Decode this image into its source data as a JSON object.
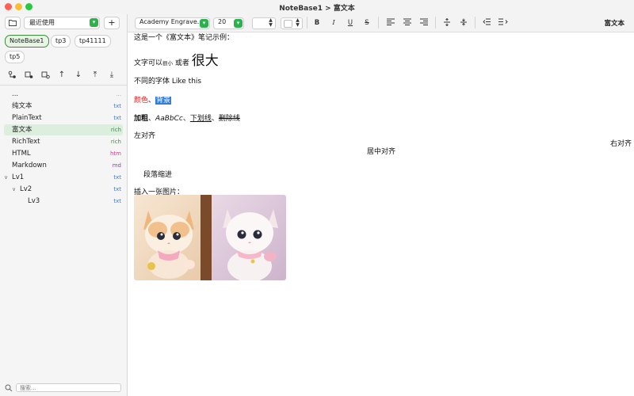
{
  "window": {
    "title": "NoteBase1 > 富文本"
  },
  "sidebar": {
    "recent_select": "最近使用",
    "add_label": "+",
    "bases": [
      "NoteBase1",
      "tp3",
      "tp41111",
      "tp5"
    ],
    "actions": [
      "add-child-icon",
      "add-sibling-icon",
      "settings-node-icon",
      "move-up-icon",
      "move-down-icon",
      "move-top-icon",
      "move-bottom-icon"
    ],
    "items": [
      {
        "name": "...",
        "ext": "...",
        "ext_color": "#9a9a9a"
      },
      {
        "name": "纯文本",
        "ext": "txt",
        "ext_color": "#3a7bd5"
      },
      {
        "name": "PlainText",
        "ext": "txt",
        "ext_color": "#3a7bd5"
      },
      {
        "name": "富文本",
        "ext": "rich",
        "ext_color": "#2e9a3a"
      },
      {
        "name": "RichText",
        "ext": "rich",
        "ext_color": "#2e9a3a"
      },
      {
        "name": "HTML",
        "ext": "htm",
        "ext_color": "#d23c8c"
      },
      {
        "name": "Markdown",
        "ext": "md",
        "ext_color": "#8a3cd2"
      },
      {
        "name": "Lv1",
        "ext": "txt",
        "ext_color": "#3a7bd5"
      },
      {
        "name": "Lv2",
        "ext": "txt",
        "ext_color": "#3a7bd5"
      },
      {
        "name": "Lv3",
        "ext": "txt",
        "ext_color": "#3a7bd5"
      }
    ],
    "search_placeholder": "搜索..."
  },
  "toolbar": {
    "font": "Academy Engrave...",
    "size": "20",
    "buttons": {
      "bold": "B",
      "italic": "I",
      "underline": "U",
      "strike": "S"
    },
    "doc_title": "富文本"
  },
  "content": {
    "intro": "这是一个《富文本》笔记示例：",
    "size_line": {
      "prefix": "文字可以",
      "small": "很小",
      "mid": " 或者 ",
      "big": "很大"
    },
    "font_line": "不同的字体 Like this",
    "color_line": {
      "red": "颜色",
      "sep": "、",
      "bg": "背景"
    },
    "style_line": {
      "bold": "加粗",
      "sep1": "、",
      "italic": "AaBbCc",
      "sep2": "、",
      "underline": "下划线",
      "sep3": "、",
      "strike": "删除线"
    },
    "left": "左对齐",
    "right": "右对齐",
    "center": "居中对齐",
    "indent": "段落缩进",
    "image_caption": "插入一张图片："
  },
  "colors": {
    "accent_green": "#2bb24c",
    "selection_bg": "#dceedd",
    "highlight": "#2f7fd6",
    "red_text": "#e02020"
  }
}
